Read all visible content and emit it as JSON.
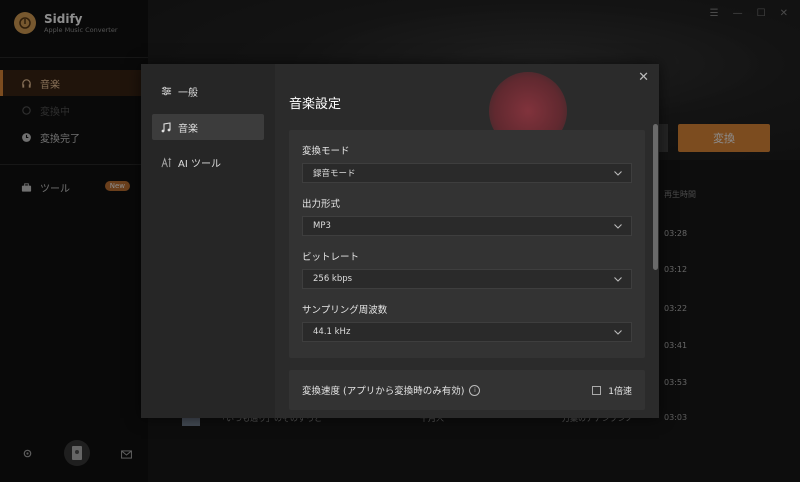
{
  "app": {
    "name": "Sidify",
    "subtitle": "Apple Music Converter"
  },
  "sidebar": {
    "items": [
      {
        "label": "音楽",
        "icon": "headphones-icon"
      },
      {
        "label": "変換中",
        "icon": "sync-icon"
      },
      {
        "label": "変換完了",
        "icon": "clock-icon"
      }
    ],
    "tools": {
      "label": "ツール",
      "badge": "New",
      "icon": "toolbox-icon"
    }
  },
  "main": {
    "convert_button": "変換",
    "duration_header": "再生時間",
    "durations": [
      "03:28",
      "03:12",
      "03:22",
      "03:41",
      "03:53"
    ],
    "last_row": {
      "title": "「いつも通り」のそのずっと",
      "album": "千月人",
      "artist": "万葉のアナンブンノ",
      "duration": "03:03"
    }
  },
  "dialog": {
    "nav": [
      {
        "label": "一般",
        "icon": "sliders-icon"
      },
      {
        "label": "音楽",
        "icon": "music-note-icon"
      },
      {
        "label": "AI ツール",
        "icon": "ai-icon"
      }
    ],
    "title": "音楽設定",
    "fields": [
      {
        "label": "変換モード",
        "value": "録音モード"
      },
      {
        "label": "出力形式",
        "value": "MP3"
      },
      {
        "label": "ビットレート",
        "value": "256 kbps"
      },
      {
        "label": "サンプリング周波数",
        "value": "44.1 kHz"
      }
    ],
    "speed": {
      "label": "変換速度 (アプリから変換時のみ有効)",
      "checkbox_label": "1倍速",
      "checked": false
    }
  },
  "colors": {
    "accent": "#e28a39",
    "dialog_bg": "#2b2b2b"
  }
}
